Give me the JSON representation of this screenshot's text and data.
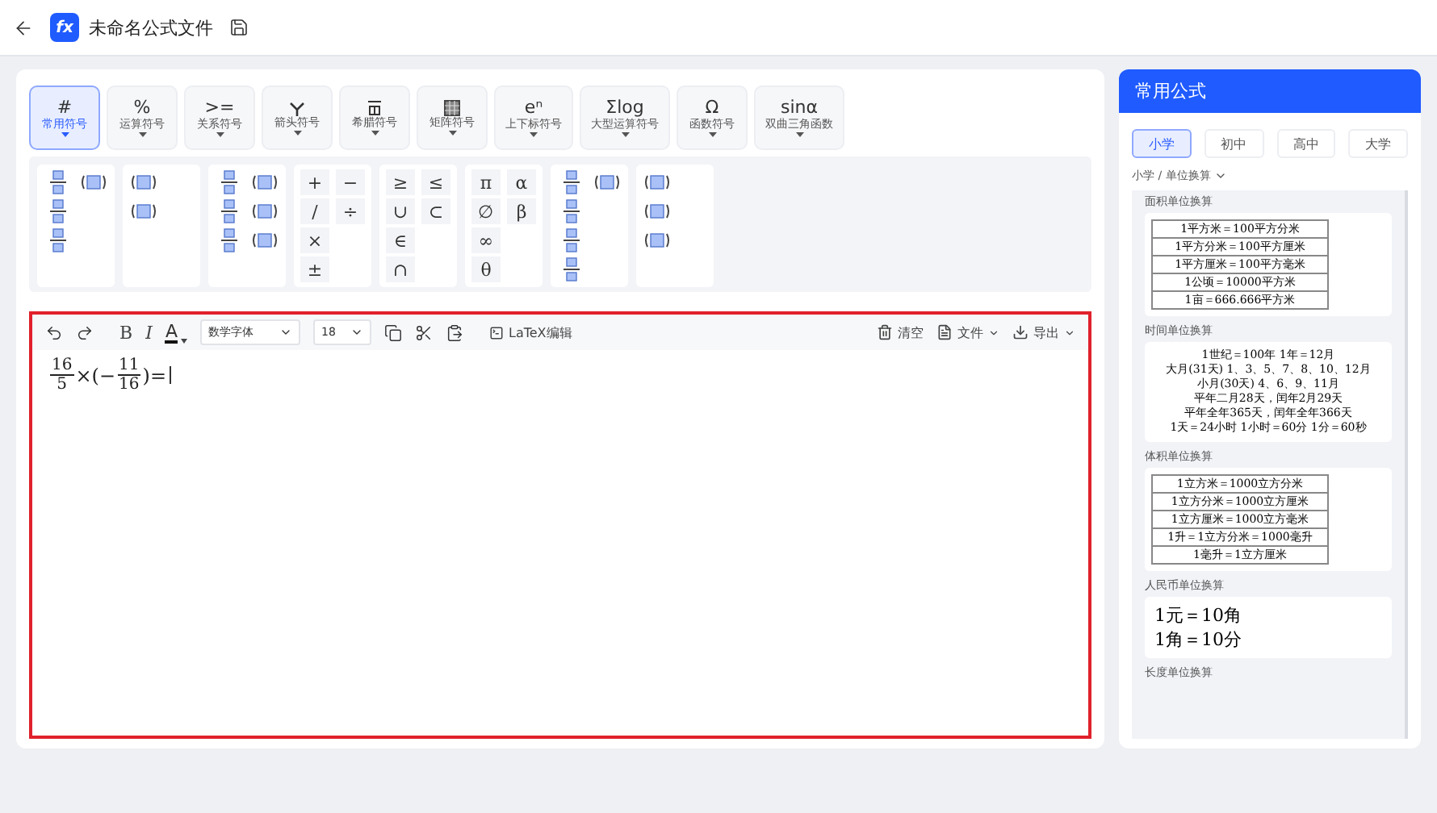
{
  "header": {
    "title": "未命名公式文件",
    "logo": "fx"
  },
  "categories": [
    {
      "symbol": "#",
      "label": "常用符号",
      "selected": true
    },
    {
      "symbol": "%",
      "label": "运算符号",
      "selected": false
    },
    {
      "symbol": ">=",
      "label": "关系符号",
      "selected": false
    },
    {
      "label": "箭头符号",
      "selected": false
    },
    {
      "label": "希腊符号",
      "selected": false
    },
    {
      "label": "矩阵符号",
      "selected": false
    },
    {
      "symbol": "eⁿ",
      "label": "上下标符号",
      "selected": false
    },
    {
      "symbol": "Σlog",
      "label": "大型运算符号",
      "selected": false
    },
    {
      "symbol": "Ω",
      "label": "函数符号",
      "selected": false
    },
    {
      "symbol": "sinα",
      "label": "双曲三角函数",
      "selected": false
    }
  ],
  "palette": [
    {
      "items": [
        {
          "kind": "template"
        },
        {
          "kind": "template"
        },
        {
          "kind": "template"
        },
        {
          "kind": "blank"
        },
        {
          "kind": "template"
        }
      ]
    },
    {
      "items": [
        {
          "kind": "template"
        },
        {
          "kind": "blank"
        },
        {
          "kind": "template"
        }
      ]
    },
    {
      "items": [
        {
          "kind": "template"
        },
        {
          "kind": "template"
        },
        {
          "kind": "template"
        },
        {
          "kind": "template"
        },
        {
          "kind": "template"
        },
        {
          "kind": "template"
        }
      ]
    },
    {
      "items": [
        {
          "kind": "glyph",
          "text": "+"
        },
        {
          "kind": "glyph",
          "text": "−"
        },
        {
          "kind": "glyph",
          "text": "/"
        },
        {
          "kind": "glyph",
          "text": "÷"
        },
        {
          "kind": "glyph",
          "text": "×"
        },
        {
          "kind": "blank"
        },
        {
          "kind": "glyph",
          "text": "±"
        }
      ]
    },
    {
      "items": [
        {
          "kind": "glyph",
          "text": "≥"
        },
        {
          "kind": "glyph",
          "text": "≤"
        },
        {
          "kind": "glyph",
          "text": "∪"
        },
        {
          "kind": "glyph",
          "text": "⊂"
        },
        {
          "kind": "glyph",
          "text": "∈"
        },
        {
          "kind": "blank"
        },
        {
          "kind": "glyph",
          "text": "∩"
        }
      ]
    },
    {
      "items": [
        {
          "kind": "glyph",
          "text": "π"
        },
        {
          "kind": "glyph",
          "text": "α"
        },
        {
          "kind": "glyph",
          "text": "∅"
        },
        {
          "kind": "glyph",
          "text": "β"
        },
        {
          "kind": "glyph",
          "text": "∞"
        },
        {
          "kind": "blank"
        },
        {
          "kind": "glyph",
          "text": "θ"
        }
      ]
    },
    {
      "items": [
        {
          "kind": "template"
        },
        {
          "kind": "template"
        },
        {
          "kind": "template"
        },
        {
          "kind": "blank"
        },
        {
          "kind": "template"
        },
        {
          "kind": "blank"
        },
        {
          "kind": "template"
        }
      ]
    },
    {
      "items": [
        {
          "kind": "template"
        },
        {
          "kind": "blank"
        },
        {
          "kind": "template"
        },
        {
          "kind": "blank"
        },
        {
          "kind": "template"
        }
      ]
    }
  ],
  "editor": {
    "bold": "B",
    "italic": "I",
    "text_color_label": "A",
    "font": "数学字体",
    "size": "18",
    "latex_button": "LaTeX编辑",
    "clear": "清空",
    "file": "文件",
    "export": "导出",
    "formula": [
      {
        "kind": "frac",
        "num": "16",
        "den": "5"
      },
      {
        "kind": "text",
        "text": "×(−"
      },
      {
        "kind": "frac",
        "num": "11",
        "den": "16"
      },
      {
        "kind": "text",
        "text": ")="
      },
      {
        "kind": "cursor"
      }
    ]
  },
  "sidebar": {
    "title": "常用公式",
    "levels": [
      {
        "label": "小学",
        "selected": true
      },
      {
        "label": "初中",
        "selected": false
      },
      {
        "label": "高中",
        "selected": false
      },
      {
        "label": "大学",
        "selected": false
      }
    ],
    "breadcrumb": "小学 / 单位换算",
    "cards": [
      {
        "title": "面积单位换算",
        "kind": "table",
        "lines": [
          "1平方米＝100平方分米",
          "1平方分米＝100平方厘米",
          "1平方厘米＝100平方毫米",
          "1公顷＝10000平方米",
          "1亩＝666.666平方米"
        ]
      },
      {
        "title": "时间单位换算",
        "kind": "plain",
        "lines": [
          "1世纪＝100年  1年＝12月",
          "大月(31天) 1、3、5、7、8、10、12月",
          "小月(30天) 4、6、9、11月",
          "平年二月28天，闰年2月29天",
          "平年全年365天，闰年全年366天",
          "1天＝24小时 1小时＝60分 1分＝60秒"
        ]
      },
      {
        "title": "体积单位换算",
        "kind": "table",
        "lines": [
          "1立方米＝1000立方分米",
          "1立方分米＝1000立方厘米",
          "1立方厘米＝1000立方毫米",
          "1升＝1立方分米＝1000毫升",
          "1毫升＝1立方厘米"
        ]
      },
      {
        "title": "人民币单位换算",
        "kind": "large",
        "lines": [
          "1元＝10角",
          "1角＝10分"
        ]
      },
      {
        "title": "长度单位换算",
        "kind": "cut"
      }
    ]
  }
}
